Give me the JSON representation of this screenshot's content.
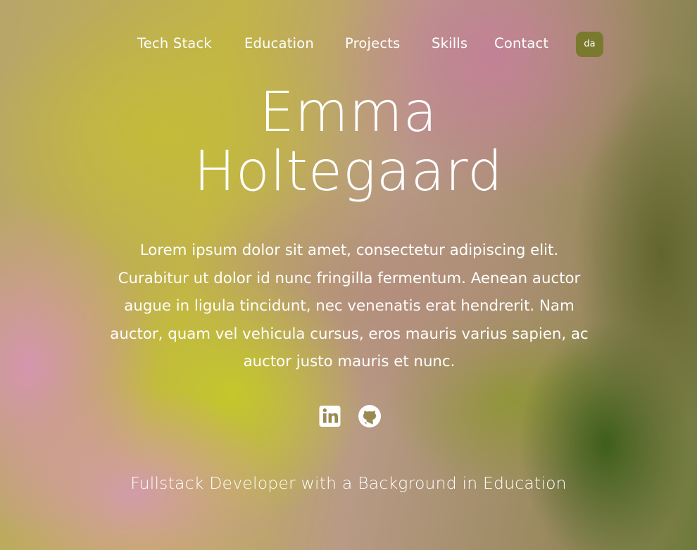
{
  "nav": {
    "items": [
      {
        "label": "Tech Stack"
      },
      {
        "label": "Education"
      },
      {
        "label": "Projects"
      },
      {
        "label": "Skills"
      },
      {
        "label": "Contact"
      }
    ],
    "language_button": "da"
  },
  "hero": {
    "name_line1": "Emma",
    "name_line2": "Holtegaard",
    "intro": "Lorem ipsum dolor sit amet, consectetur adipiscing elit. Curabitur ut dolor id nunc fringilla fermentum. Aenean auctor augue in ligula tincidunt, nec venenatis erat hendrerit. Nam auctor, quam vel vehicula cursus, eros mauris varius sapien, ac auctor justo mauris et nunc.",
    "socials": [
      {
        "icon": "linkedin-icon"
      },
      {
        "icon": "github-icon"
      }
    ],
    "tagline": "Fullstack Developer with a Background in Education"
  },
  "colors": {
    "text": "#ffffff",
    "language_button_bg": "#7a7a2e"
  }
}
